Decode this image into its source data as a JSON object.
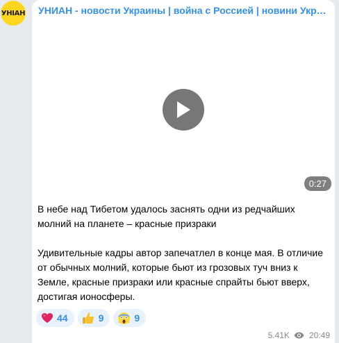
{
  "channel": {
    "avatar_text": "УНІАН",
    "name": "УНИАН - новости Украины | война с Россией | новини України | Украина"
  },
  "video": {
    "duration": "0:27"
  },
  "message": {
    "paragraph_1": "В небе над Тибетом удалось заснять одни из редчайших молний на планете – красные призраки",
    "paragraph_2": "Удивительные кадры автор запечатлел в конце мая. В отличие от обычных молний, которые бьют из грозовых туч вниз к Земле, красные призраки или красные спрайты бьют вверх, достигая ионосферы."
  },
  "reactions": [
    {
      "emoji": "heart",
      "count": "44"
    },
    {
      "emoji": "thumbs-up",
      "count": "9"
    },
    {
      "emoji": "screaming-face",
      "count": "9"
    }
  ],
  "meta": {
    "views": "5.41K",
    "time": "20:49"
  },
  "colors": {
    "accent": "#3390ec",
    "background": "#e7ebf0",
    "avatar": "#ffd71e"
  }
}
